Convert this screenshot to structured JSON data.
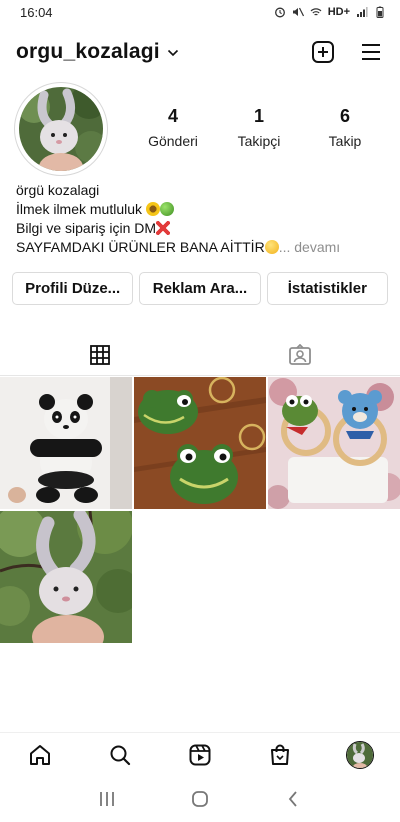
{
  "status_bar": {
    "time": "16:04",
    "network": "HD+",
    "icons": [
      "alarm-icon",
      "mute-icon",
      "wifi-icon",
      "signal-icon",
      "battery-icon"
    ]
  },
  "header": {
    "username": "orgu_kozalagi",
    "icons": [
      "chevron-down-icon",
      "new-post-icon",
      "menu-icon"
    ]
  },
  "profile": {
    "stats": [
      {
        "value": "4",
        "label": "Gönderi"
      },
      {
        "value": "1",
        "label": "Takipçi"
      },
      {
        "value": "6",
        "label": "Takip"
      }
    ],
    "bio": {
      "name": "örgü kozalagi",
      "line1": "İlmek ilmek mutluluk",
      "line2": "Bilgi ve sipariş için DM",
      "line3": "SAYFAMDAKI ÜRÜNLER BANA AİTTİR",
      "more": "... devamı"
    }
  },
  "buttons": {
    "edit_profile": "Profili Düze...",
    "ad_tools": "Reklam Ara...",
    "insights": "İstatistikler"
  },
  "tabs": [
    {
      "name": "grid",
      "icon": "grid-icon",
      "active": true
    },
    {
      "name": "tagged",
      "icon": "tagged-icon",
      "active": false
    }
  ],
  "posts": [
    {
      "subject": "panda-amigurumi"
    },
    {
      "subject": "frog-keychains"
    },
    {
      "subject": "frog-and-bear-rattles"
    },
    {
      "subject": "bunny-amigurumi"
    }
  ],
  "bottom_nav": [
    "home-icon",
    "search-icon",
    "reels-icon",
    "shop-icon",
    "profile-avatar"
  ],
  "system_nav": [
    "recents-icon",
    "home-button-icon",
    "back-icon"
  ],
  "colors": {
    "text": "#111111",
    "secondary": "#8e8e8e",
    "border": "#dbdbdb"
  }
}
